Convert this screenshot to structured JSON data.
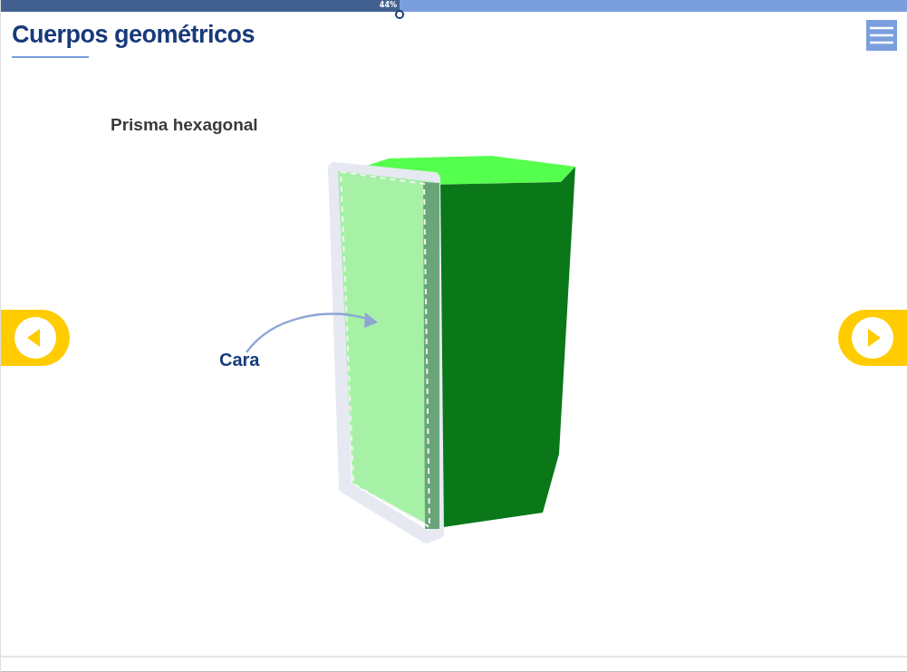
{
  "progress": {
    "level": 0.44,
    "label": "44%"
  },
  "title": "Cuerpos geométricos",
  "subtitle": "Prisma hexagonal",
  "callout": {
    "label": "Cara"
  }
}
